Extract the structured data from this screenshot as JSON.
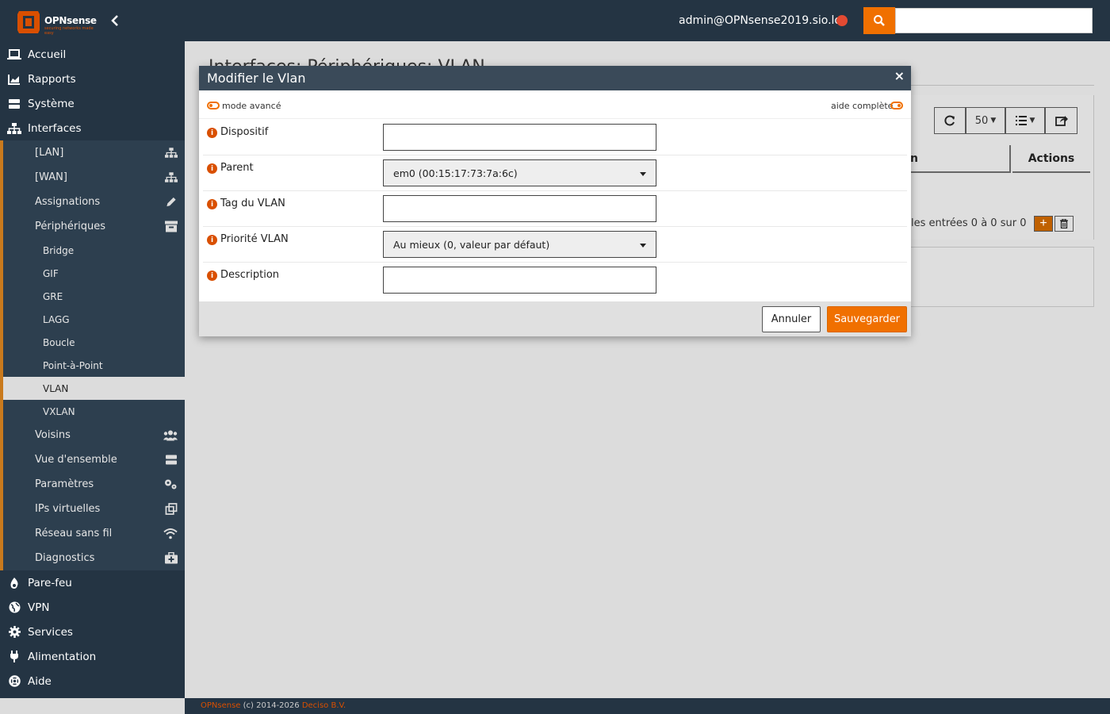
{
  "header": {
    "logo_text": "OPNsense",
    "logo_tagline": "securing networks made easy",
    "user": "admin@OPNsense2019.sio.loc",
    "search_value": ""
  },
  "sidebar": {
    "items": [
      {
        "label": "Accueil",
        "icon": "laptop-icon"
      },
      {
        "label": "Rapports",
        "icon": "area-chart-icon"
      },
      {
        "label": "Système",
        "icon": "server-icon"
      },
      {
        "label": "Interfaces",
        "icon": "sitemap-icon"
      },
      {
        "label": "[LAN]",
        "icon": "sitemap-icon"
      },
      {
        "label": "[WAN]",
        "icon": "sitemap-icon"
      },
      {
        "label": "Assignations",
        "icon": "pencil-icon"
      },
      {
        "label": "Périphériques",
        "icon": "archive-icon"
      },
      {
        "label": "Bridge"
      },
      {
        "label": "GIF"
      },
      {
        "label": "GRE"
      },
      {
        "label": "LAGG"
      },
      {
        "label": "Boucle"
      },
      {
        "label": "Point-à-Point"
      },
      {
        "label": "VLAN"
      },
      {
        "label": "VXLAN"
      },
      {
        "label": "Voisins",
        "icon": "users-icon"
      },
      {
        "label": "Vue d'ensemble",
        "icon": "server-icon"
      },
      {
        "label": "Paramètres",
        "icon": "cogs-icon"
      },
      {
        "label": "IPs virtuelles",
        "icon": "clone-icon"
      },
      {
        "label": "Réseau sans fil",
        "icon": "wifi-icon"
      },
      {
        "label": "Diagnostics",
        "icon": "medkit-icon"
      },
      {
        "label": "Pare-feu",
        "icon": "fire-icon"
      },
      {
        "label": "VPN",
        "icon": "globe-icon"
      },
      {
        "label": "Services",
        "icon": "cog-icon"
      },
      {
        "label": "Alimentation",
        "icon": "plug-icon"
      },
      {
        "label": "Aide",
        "icon": "life-ring-icon"
      }
    ]
  },
  "background": {
    "page_title": "Interfaces: Périphériques: VLAN",
    "page_size": "50",
    "col_partial": "n",
    "col_actions": "Actions",
    "footer_info": "les entrées 0 à 0 sur 0",
    "add": "+"
  },
  "modal": {
    "title": "Modifier le Vlan",
    "close": "×",
    "advanced_mode": "mode avancé",
    "full_help": "aide complète",
    "fields": [
      {
        "label": "Dispositif",
        "value": ""
      },
      {
        "label": "Parent",
        "value": "em0 (00:15:17:73:7a:6c)"
      },
      {
        "label": "Tag du VLAN",
        "value": ""
      },
      {
        "label": "Priorité VLAN",
        "value": "Au mieux (0, valeur par défaut)"
      },
      {
        "label": "Description",
        "value": ""
      }
    ],
    "cancel": "Annuler",
    "save": "Sauvegarder"
  },
  "footer": {
    "brand": "OPNsense",
    "copyright": "(c) 2014-2026",
    "company": "Deciso B.V."
  },
  "colors": {
    "accent": "#f07000",
    "sidebar_bg": "#243443",
    "header_bg": "#3a4a59"
  }
}
